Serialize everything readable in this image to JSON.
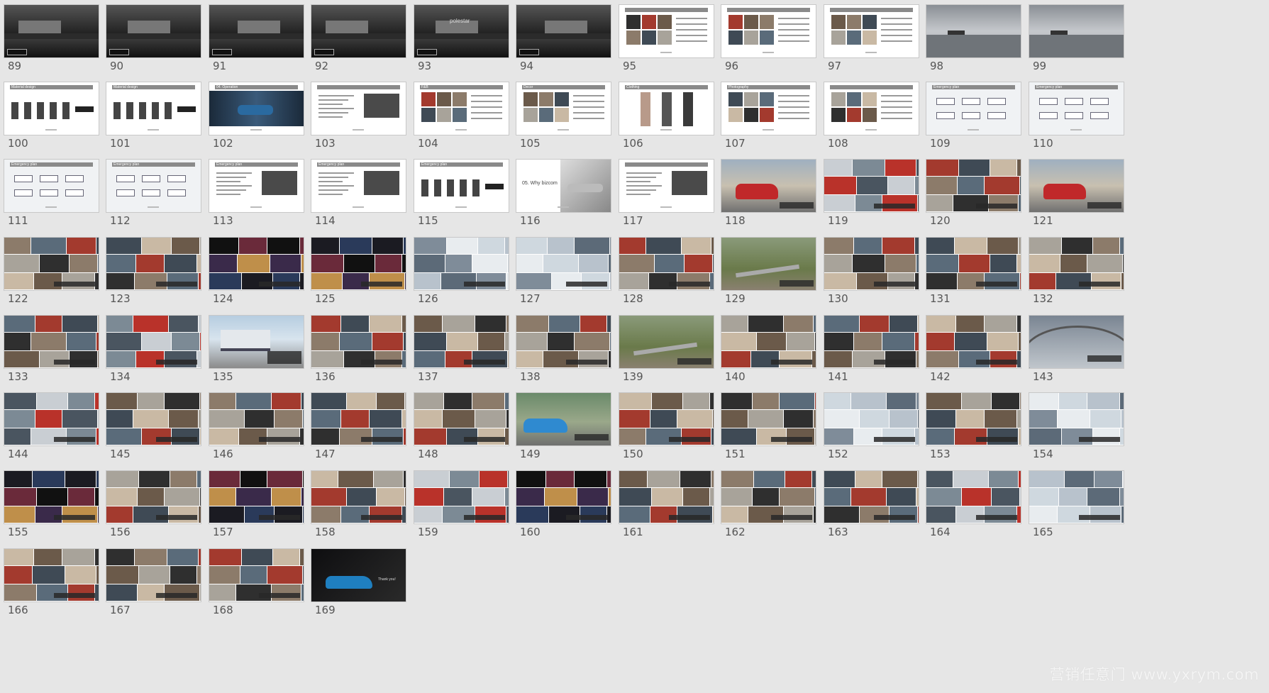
{
  "slides": [
    {
      "n": "89",
      "style": "dark"
    },
    {
      "n": "90",
      "style": "dark"
    },
    {
      "n": "91",
      "style": "dark"
    },
    {
      "n": "92",
      "style": "dark"
    },
    {
      "n": "93",
      "style": "dark",
      "caption": "polestar"
    },
    {
      "n": "94",
      "style": "dark"
    },
    {
      "n": "95",
      "style": "doc-photos"
    },
    {
      "n": "96",
      "style": "doc-photos"
    },
    {
      "n": "97",
      "style": "doc-photos"
    },
    {
      "n": "98",
      "style": "road"
    },
    {
      "n": "99",
      "style": "road"
    },
    {
      "n": "100",
      "style": "doc-items",
      "header": "Material design"
    },
    {
      "n": "101",
      "style": "doc-items",
      "header": "Material design"
    },
    {
      "n": "102",
      "style": "opening",
      "header": "04. Operation"
    },
    {
      "n": "103",
      "style": "doc-text"
    },
    {
      "n": "104",
      "style": "doc-photos",
      "header": "F&B"
    },
    {
      "n": "105",
      "style": "doc-photos",
      "header": "Decor"
    },
    {
      "n": "106",
      "style": "doc-people",
      "header": "Clothing"
    },
    {
      "n": "107",
      "style": "doc-photos",
      "header": "Photography"
    },
    {
      "n": "108",
      "style": "doc-photos"
    },
    {
      "n": "109",
      "style": "doc-diagram",
      "header": "Emergency plan"
    },
    {
      "n": "110",
      "style": "doc-diagram",
      "header": "Emergency plan"
    },
    {
      "n": "111",
      "style": "doc-diagram",
      "header": "Emergency plan"
    },
    {
      "n": "112",
      "style": "doc-diagram",
      "header": "Emergency plan"
    },
    {
      "n": "113",
      "style": "doc-text",
      "header": "Emergency plan"
    },
    {
      "n": "114",
      "style": "doc-text",
      "header": "Emergency plan"
    },
    {
      "n": "115",
      "style": "doc-items",
      "header": "Emergency plan"
    },
    {
      "n": "116",
      "style": "why",
      "caption": "05. Why bizcom"
    },
    {
      "n": "117",
      "style": "doc-text"
    },
    {
      "n": "118",
      "style": "photo-red"
    },
    {
      "n": "119",
      "style": "collage"
    },
    {
      "n": "120",
      "style": "collage"
    },
    {
      "n": "121",
      "style": "photo-red"
    },
    {
      "n": "122",
      "style": "collage"
    },
    {
      "n": "123",
      "style": "collage"
    },
    {
      "n": "124",
      "style": "night"
    },
    {
      "n": "125",
      "style": "night"
    },
    {
      "n": "126",
      "style": "snow"
    },
    {
      "n": "127",
      "style": "snow"
    },
    {
      "n": "128",
      "style": "collage"
    },
    {
      "n": "129",
      "style": "landscape"
    },
    {
      "n": "130",
      "style": "collage"
    },
    {
      "n": "131",
      "style": "collage"
    },
    {
      "n": "132",
      "style": "collage"
    },
    {
      "n": "133",
      "style": "collage"
    },
    {
      "n": "134",
      "style": "collage"
    },
    {
      "n": "135",
      "style": "building"
    },
    {
      "n": "136",
      "style": "collage"
    },
    {
      "n": "137",
      "style": "collage"
    },
    {
      "n": "138",
      "style": "collage"
    },
    {
      "n": "139",
      "style": "landscape"
    },
    {
      "n": "140",
      "style": "collage"
    },
    {
      "n": "141",
      "style": "collage"
    },
    {
      "n": "142",
      "style": "collage"
    },
    {
      "n": "143",
      "style": "bridge"
    },
    {
      "n": "144",
      "style": "collage"
    },
    {
      "n": "145",
      "style": "collage"
    },
    {
      "n": "146",
      "style": "collage"
    },
    {
      "n": "147",
      "style": "collage"
    },
    {
      "n": "148",
      "style": "collage"
    },
    {
      "n": "149",
      "style": "photo-blue"
    },
    {
      "n": "150",
      "style": "collage"
    },
    {
      "n": "151",
      "style": "collage"
    },
    {
      "n": "152",
      "style": "snow"
    },
    {
      "n": "153",
      "style": "collage"
    },
    {
      "n": "154",
      "style": "snow"
    },
    {
      "n": "155",
      "style": "night"
    },
    {
      "n": "156",
      "style": "collage"
    },
    {
      "n": "157",
      "style": "night"
    },
    {
      "n": "158",
      "style": "collage"
    },
    {
      "n": "159",
      "style": "collage"
    },
    {
      "n": "160",
      "style": "night"
    },
    {
      "n": "161",
      "style": "collage"
    },
    {
      "n": "162",
      "style": "collage"
    },
    {
      "n": "163",
      "style": "collage"
    },
    {
      "n": "164",
      "style": "collage"
    },
    {
      "n": "165",
      "style": "snow"
    },
    {
      "n": "166",
      "style": "collage"
    },
    {
      "n": "167",
      "style": "collage"
    },
    {
      "n": "168",
      "style": "collage"
    },
    {
      "n": "169",
      "style": "thanks",
      "caption": "Thank you!"
    }
  ],
  "watermark": "营销任意门 www.yxrym.com"
}
